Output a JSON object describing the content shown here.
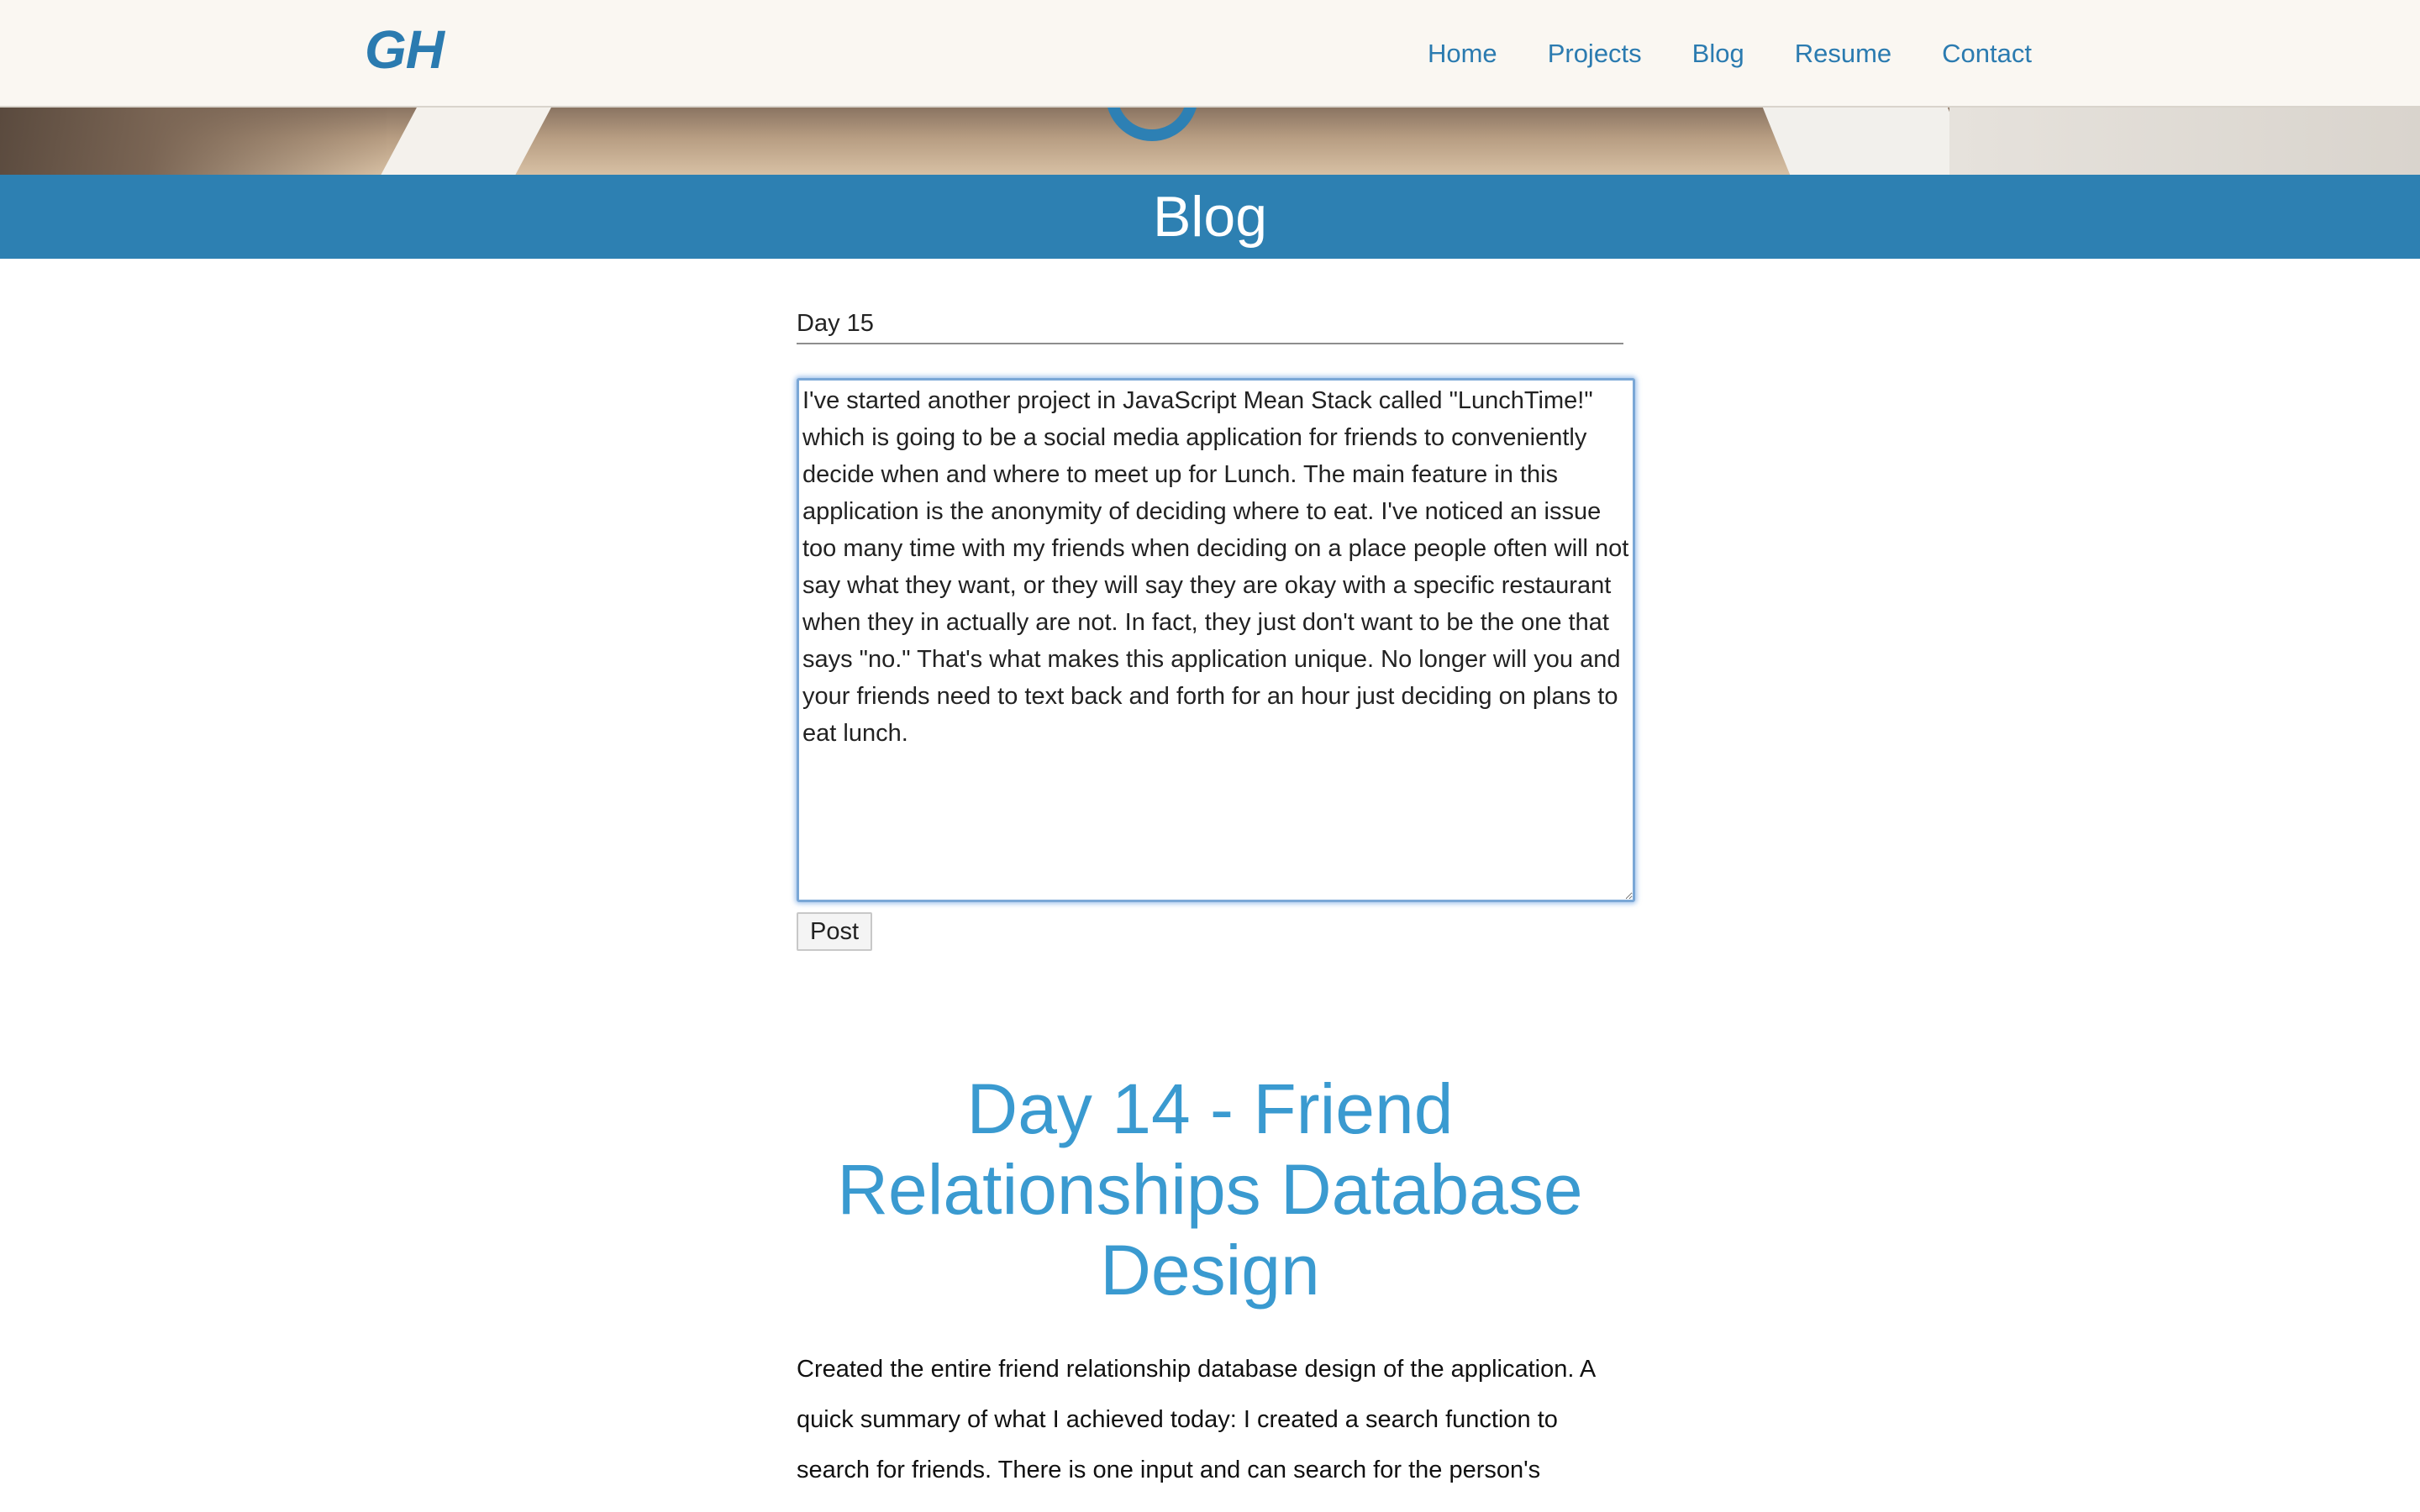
{
  "nav": {
    "brand": "GH",
    "links": [
      "Home",
      "Projects",
      "Blog",
      "Resume",
      "Contact"
    ]
  },
  "banner": {
    "title": "Blog"
  },
  "editor": {
    "title_value": "Day 15",
    "body_value": "I've started another project in JavaScript Mean Stack called \"LunchTime!\" which is going to be a social media application for friends to conveniently decide when and where to meet up for Lunch. The main feature in this application is the anonymity of deciding where to eat. I've noticed an issue too many time with my friends when deciding on a place people often will not say what they want, or they will say they are okay with a specific restaurant when they in actually are not. In fact, they just don't want to be the one that says \"no.\" That's what makes this application unique. No longer will you and your friends need to text back and forth for an hour just deciding on plans to eat lunch.",
    "post_label": "Post"
  },
  "post": {
    "title": "Day 14 - Friend Relationships Database Design",
    "body": "Created the entire friend relationship database design of the application. A quick summary of what I achieved today: I created a search function to search for friends. There is one input and can search for the person's"
  },
  "colors": {
    "accent": "#2b7bb0",
    "banner": "#2d80b2",
    "post_title": "#3a9ad0",
    "navbar_bg": "#faf7f2"
  }
}
